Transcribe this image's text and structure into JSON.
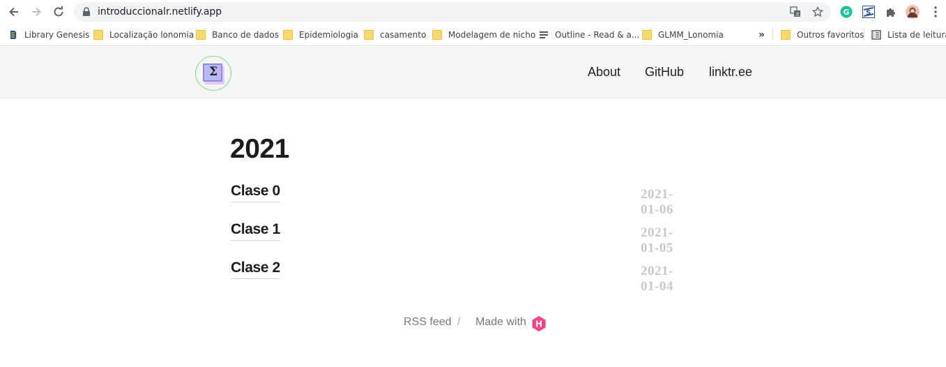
{
  "browser": {
    "url": "introduccionalr.netlify.app",
    "bookmarks": [
      {
        "label": "Library Genesis",
        "icon": "libgen-icon"
      },
      {
        "label": "Localização lonomia",
        "icon": "folder-icon"
      },
      {
        "label": "Banco de dados",
        "icon": "folder-icon"
      },
      {
        "label": "Epidemiologia",
        "icon": "folder-icon"
      },
      {
        "label": "casamento",
        "icon": "folder-icon"
      },
      {
        "label": "Modelagem de nicho",
        "icon": "folder-icon"
      },
      {
        "label": "Outline - Read & a...",
        "icon": "outline-icon"
      },
      {
        "label": "GLMM_Lonomia",
        "icon": "folder-icon"
      }
    ],
    "overflow": "»",
    "other_bookmarks": "Outros favoritos",
    "reading_list": "Lista de leitura"
  },
  "site": {
    "logo_symbol": "Σ",
    "menu": [
      "About",
      "GitHub",
      "linktr.ee"
    ]
  },
  "main": {
    "year": "2021",
    "posts": [
      {
        "title": "Clase 0",
        "date": "2021-01-06"
      },
      {
        "title": "Clase 1",
        "date": "2021-01-05"
      },
      {
        "title": "Clase 2",
        "date": "2021-01-04"
      }
    ]
  },
  "footer": {
    "rss": "RSS feed",
    "separator": "/",
    "made_with": "Made with",
    "hugo_letter": "H"
  },
  "colors": {
    "header_bg": "#f5f5f5",
    "date_color": "#c8c8c8",
    "hugo_pink": "#ff4088"
  }
}
